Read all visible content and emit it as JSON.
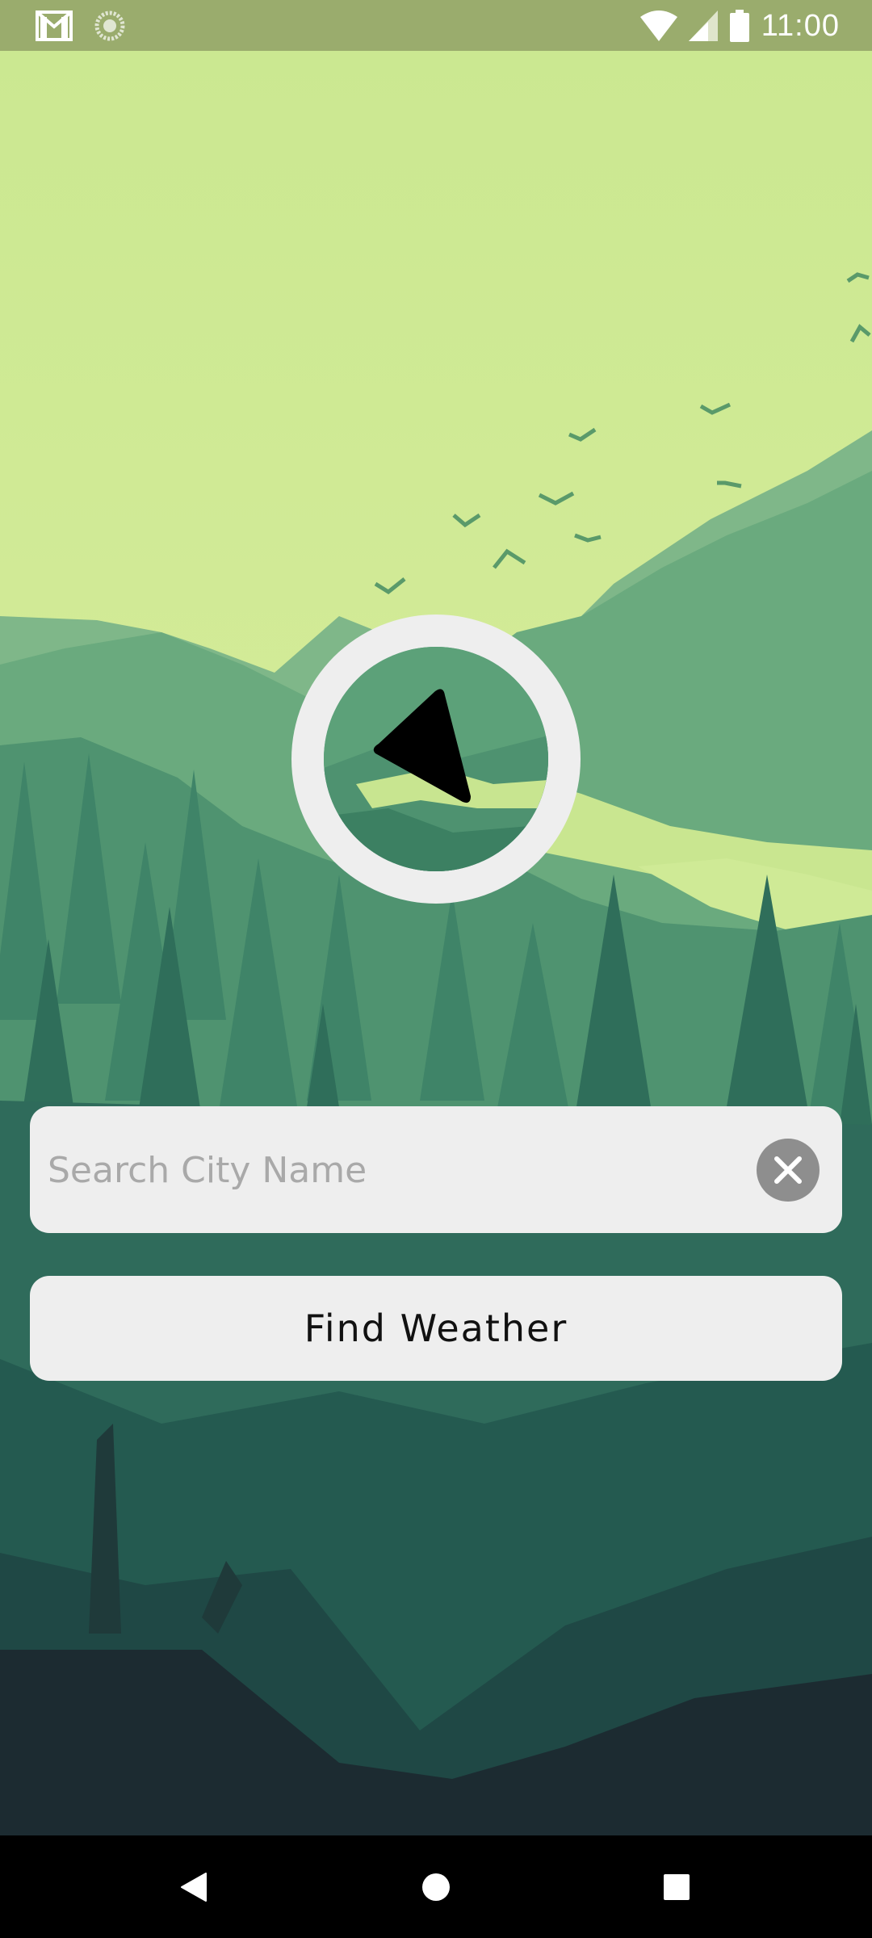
{
  "status_bar": {
    "time": "11:00",
    "icons": [
      "gmail-icon",
      "sync-icon",
      "wifi-icon",
      "signal-icon",
      "battery-icon"
    ]
  },
  "compass": {
    "icon": "navigation-arrow-icon"
  },
  "search": {
    "placeholder": "Search City Name",
    "value": "",
    "clear_icon": "close-icon"
  },
  "actions": {
    "find_label": "Find Weather"
  },
  "nav_bar": {
    "icons": [
      "back-icon",
      "home-icon",
      "recents-icon"
    ]
  },
  "colors": {
    "status_bar": "#9aac6d",
    "sky": "#cde791",
    "field_bg": "#eeeeee",
    "placeholder": "#a9a9a9",
    "clear_button": "#8e8e8e"
  }
}
